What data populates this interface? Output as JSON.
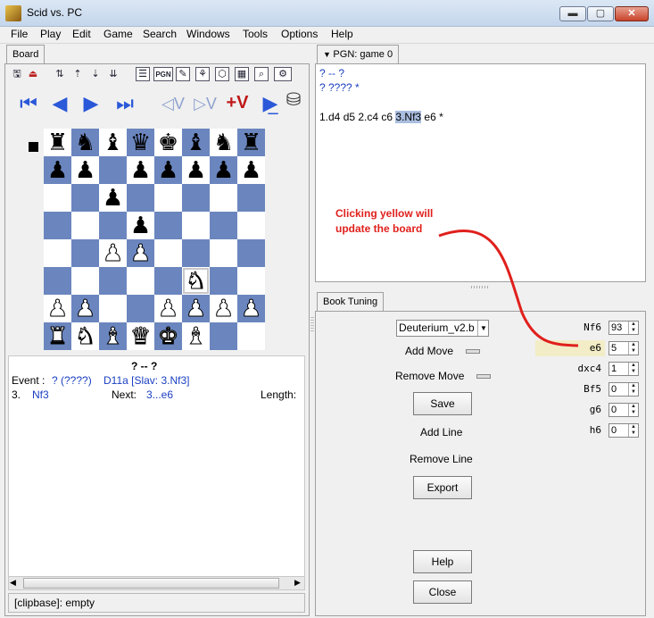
{
  "window": {
    "title": "Scid vs. PC",
    "min": "▬",
    "max": "▢",
    "close": "✕"
  },
  "menu": [
    "File",
    "Play",
    "Edit",
    "Game",
    "Search",
    "Windows",
    "Tools",
    "Options",
    "Help"
  ],
  "board_tab": "Board",
  "pgn_tab": "PGN: game 0",
  "pgn": {
    "line1": "?  --  ?",
    "line2": "?  ????  *",
    "moves_before": "1.d4 d5 2.c4 c6 ",
    "move_selected": "3.Nf3",
    "moves_after": " e6 *"
  },
  "annotation": {
    "line1": "Clicking yellow will",
    "line2": "update the board",
    "color": "#e0201c"
  },
  "board": {
    "rows": [
      [
        "r",
        "n",
        "b",
        "q",
        "k",
        "b",
        "n",
        "r"
      ],
      [
        "p",
        "p",
        "",
        "p",
        "p",
        "p",
        "p",
        "p"
      ],
      [
        "",
        "",
        "p",
        "",
        "",
        "",
        "",
        ""
      ],
      [
        "",
        "",
        "",
        "p",
        "",
        "",
        "",
        ""
      ],
      [
        "",
        "",
        "P",
        "P",
        "",
        "",
        "",
        ""
      ],
      [
        "",
        "",
        "",
        "",
        "",
        "N",
        "",
        ""
      ],
      [
        "P",
        "P",
        "",
        "",
        "P",
        "P",
        "P",
        "P"
      ],
      [
        "R",
        "N",
        "B",
        "Q",
        "K",
        "B",
        "",
        ""
      ]
    ],
    "last_move_square": "f3",
    "side_to_move": "black",
    "light_color": "#ffffff",
    "dark_color": "#6b86bf"
  },
  "info": {
    "players": "?  --  ?",
    "event_label": "Event :",
    "event_value": "?  (????)",
    "eco": "D11a [Slav: 3.Nf3]",
    "move_no": "3.",
    "move": "Nf3",
    "next_label": "Next:",
    "next_move": "3...e6",
    "length_label": "Length:"
  },
  "status": "[clipbase]:  empty",
  "book": {
    "tab": "Book Tuning",
    "book_name": "Deuterium_v2.b",
    "add_move": "Add Move",
    "remove_move": "Remove Move",
    "save": "Save",
    "add_line": "Add Line",
    "remove_line": "Remove Line",
    "export": "Export",
    "help": "Help",
    "close": "Close",
    "moves": [
      {
        "move": "Nf6",
        "weight": "93",
        "highlight": false
      },
      {
        "move": "e6",
        "weight": "5",
        "highlight": true
      },
      {
        "move": "dxc4",
        "weight": "1",
        "highlight": false
      },
      {
        "move": "Bf5",
        "weight": "0",
        "highlight": false
      },
      {
        "move": "g6",
        "weight": "0",
        "highlight": false
      },
      {
        "move": "h6",
        "weight": "0",
        "highlight": false
      }
    ],
    "highlight_color": "#f2edc6"
  },
  "icons": {
    "nav": [
      "first-icon",
      "back-icon",
      "forward-icon",
      "last-icon",
      "variation-back-icon",
      "variation-forward-icon",
      "add-variation-icon",
      "autoplay-icon",
      "engine-icon"
    ],
    "nav_glyphs": [
      "⏮",
      "◀",
      "▶",
      "⏭",
      "◁V",
      "▷V",
      "+V",
      "▶̲",
      "⛁"
    ]
  }
}
